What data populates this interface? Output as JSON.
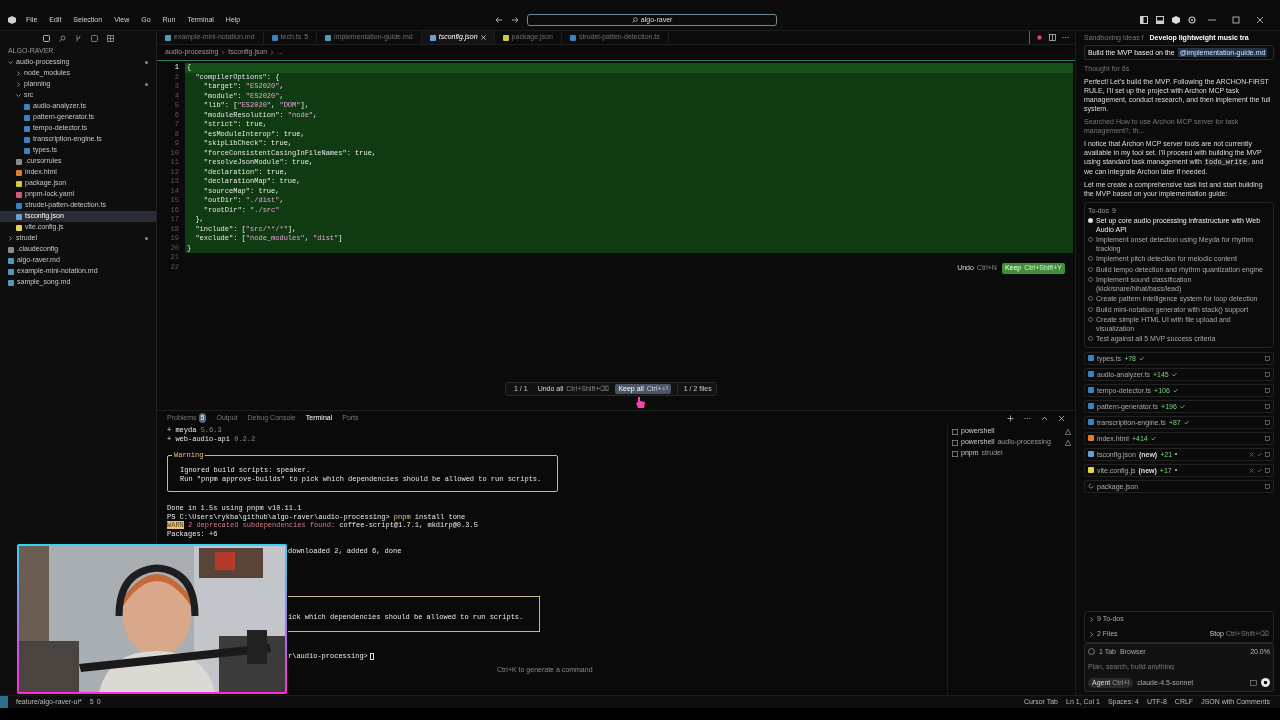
{
  "menu": [
    "File",
    "Edit",
    "Selection",
    "View",
    "Go",
    "Run",
    "Terminal",
    "Help"
  ],
  "search": "algo-raver",
  "explorer": {
    "title": "ALGO-RAVER",
    "tree": [
      {
        "name": "audio-processing",
        "kind": "folder",
        "expanded": true,
        "modified": true,
        "selected": false,
        "children": [
          {
            "name": "node_modules",
            "kind": "folder",
            "expanded": false,
            "modified": false,
            "selected": false
          },
          {
            "name": "planning",
            "kind": "folder",
            "expanded": false,
            "modified": true,
            "selected": false
          },
          {
            "name": "src",
            "kind": "folder",
            "expanded": true,
            "modified": false,
            "selected": false,
            "children": [
              {
                "name": "audio-analyzer.ts",
                "kind": "ts",
                "modified": false,
                "selected": false
              },
              {
                "name": "pattern-generator.ts",
                "kind": "ts",
                "modified": false,
                "selected": false
              },
              {
                "name": "tempo-detector.ts",
                "kind": "ts",
                "modified": false,
                "selected": false
              },
              {
                "name": "transcription-engine.ts",
                "kind": "ts",
                "modified": false,
                "selected": false
              },
              {
                "name": "types.ts",
                "kind": "ts",
                "modified": false,
                "selected": false
              }
            ]
          },
          {
            "name": ".cursorrules",
            "kind": "config",
            "modified": false,
            "selected": false
          },
          {
            "name": "index.html",
            "kind": "html",
            "modified": false,
            "selected": false
          },
          {
            "name": "package.json",
            "kind": "json",
            "modified": false,
            "selected": false
          },
          {
            "name": "pnpm-lock.yaml",
            "kind": "yaml",
            "modified": false,
            "selected": false
          },
          {
            "name": "strudel-patten-detection.ts",
            "kind": "ts",
            "modified": false,
            "selected": false
          },
          {
            "name": "tsconfig.json",
            "kind": "tsconfig",
            "modified": false,
            "selected": true
          },
          {
            "name": "vite.config.js",
            "kind": "js",
            "modified": false,
            "selected": false
          }
        ]
      },
      {
        "name": "strudel",
        "kind": "folder",
        "expanded": false,
        "modified": true,
        "selected": false
      },
      {
        "name": ".claudeconfig",
        "kind": "config",
        "modified": false,
        "selected": false
      },
      {
        "name": "algo-raver.md",
        "kind": "md",
        "modified": false,
        "selected": false
      },
      {
        "name": "example-mini-notation.md",
        "kind": "md",
        "modified": false,
        "selected": false
      },
      {
        "name": "sample_song.md",
        "kind": "md",
        "modified": false,
        "selected": false
      }
    ]
  },
  "tabs": [
    {
      "label": "example-mini-notation.md",
      "kind": "md",
      "selected": false
    },
    {
      "label": "tech.ts",
      "kind": "ts",
      "badge": "5",
      "selected": false
    },
    {
      "label": "implementation-guide.md",
      "kind": "md",
      "selected": false
    },
    {
      "label": "tsconfig.json",
      "kind": "tsconfig",
      "selected": true
    },
    {
      "label": "package.json",
      "kind": "json",
      "selected": false
    },
    {
      "label": "strudel-patten-detection.ts",
      "kind": "ts",
      "selected": false
    }
  ],
  "breadcrumbs": [
    "audio-processing",
    "tsconfig.json",
    "..."
  ],
  "code": [
    {
      "number": "1",
      "text": "{",
      "active": true
    },
    {
      "number": "2",
      "text": "  \"compilerOptions\": {",
      "active": false
    },
    {
      "number": "3",
      "text": "    \"target\": \"ES2020\",",
      "active": false
    },
    {
      "number": "4",
      "text": "    \"module\": \"ES2020\",",
      "active": false
    },
    {
      "number": "5",
      "text": "    \"lib\": [\"ES2020\", \"DOM\"],",
      "active": false
    },
    {
      "number": "6",
      "text": "    \"moduleResolution\": \"node\",",
      "active": false
    },
    {
      "number": "7",
      "text": "    \"strict\": true,",
      "active": false
    },
    {
      "number": "8",
      "text": "    \"esModuleInterop\": true,",
      "active": false
    },
    {
      "number": "9",
      "text": "    \"skipLibCheck\": true,",
      "active": false
    },
    {
      "number": "10",
      "text": "    \"forceConsistentCasingInFileNames\": true,",
      "active": false
    },
    {
      "number": "11",
      "text": "    \"resolveJsonModule\": true,",
      "active": false
    },
    {
      "number": "12",
      "text": "    \"declaration\": true,",
      "active": false
    },
    {
      "number": "13",
      "text": "    \"declarationMap\": true,",
      "active": false
    },
    {
      "number": "14",
      "text": "    \"sourceMap\": true,",
      "active": false
    },
    {
      "number": "15",
      "text": "    \"outDir\": \"./dist\",",
      "active": false
    },
    {
      "number": "16",
      "text": "    \"rootDir\": \"./src\"",
      "active": false
    },
    {
      "number": "17",
      "text": "  },",
      "active": false
    },
    {
      "number": "18",
      "text": "  \"include\": [\"src/**/*\"],",
      "active": false
    },
    {
      "number": "19",
      "text": "  \"exclude\": [\"node_modules\", \"dist\"]",
      "active": false
    },
    {
      "number": "20",
      "text": "}",
      "active": false
    },
    {
      "number": "21",
      "active": false
    },
    {
      "number": "22",
      "active": false
    }
  ],
  "inline_actions": {
    "undo": "Undo",
    "undo_shortcut": "Ctrl+N",
    "keep": "Keep",
    "keep_shortcut": "Ctrl+Shift+Y"
  },
  "review_bar": {
    "counter": "1 / 1",
    "undo_all": "Undo all",
    "undo_all_shortcut": "Ctrl+Shift+⌫",
    "keep_all": "Keep all",
    "keep_all_shortcut": "Ctrl+⏎",
    "files": "1 / 2 files"
  },
  "panel": {
    "tabs": [
      {
        "label": "Problems",
        "badge": "5",
        "selected": false
      },
      {
        "label": "Output",
        "selected": false
      },
      {
        "label": "Debug Console",
        "selected": false
      },
      {
        "label": "Terminal",
        "selected": true
      },
      {
        "label": "Ports",
        "selected": false
      }
    ],
    "terminal": [
      {
        "kind": "package",
        "prefix": "+",
        "name": "meyda",
        "version": "5.6.3"
      },
      {
        "kind": "package",
        "prefix": "+",
        "name": "web-audio-api",
        "version": "0.2.2"
      },
      {
        "kind": "box",
        "title": "Warning",
        "lines": [
          "Ignored build scripts: speaker.",
          "Run \"pnpm approve-builds\" to pick which dependencies should be allowed to run scripts."
        ]
      },
      {
        "kind": "text",
        "text": "Done in 1.5s using pnpm v10.11.1"
      },
      {
        "kind": "prompt",
        "path": "PS C:\\Users\\rykba\\github\\algo-raver\\audio-processing>",
        "command": "pnpm",
        "args": "install tone"
      },
      {
        "kind": "warn",
        "badge": "WARN",
        "message": "2 deprecated subdependencies found:",
        "detail": "coffee-script@1.7.1, mkdirp@0.3.5"
      },
      {
        "kind": "text",
        "text": "Packages: +6"
      },
      {
        "kind": "hidden_text",
        "text": "downloaded 2, added 6, done"
      },
      {
        "kind": "hidden_box",
        "lines": [
          "ick which dependencies should be allowed to run scripts."
        ]
      },
      {
        "kind": "hidden_prompt",
        "text": "r\\audio-processing>"
      }
    ],
    "terminals": [
      {
        "label": "powershell",
        "warning": true
      },
      {
        "label": "powershell",
        "detail": "audio-processing",
        "warning": true
      },
      {
        "label": "pnpm",
        "detail": "strudel",
        "warning": false
      }
    ],
    "hint": "Ctrl+K to generate a command"
  },
  "chat": {
    "tabs": [
      {
        "label": "Sandboxing ideas f",
        "selected": false
      },
      {
        "label": "Develop lightweight music tra",
        "selected": true
      }
    ],
    "prompt": "Build the MVP based on the",
    "mention": "@implementation-guide.md",
    "thought": "Thought for 6s",
    "intro": "Perfect! Let's build the MVP. Following the ARCHON-FIRST RULE, I'll set up the project with Archon MCP task management, conduct research, and then implement the full system.",
    "searched": "Searched How to use Archon MCP server for task management?, th...",
    "notice_before": "I notice that Archon MCP server tools are not currently available in my tool set. I'll proceed with building the MVP using standard task management with",
    "notice_code": "todo_write",
    "notice_after": ", and we can integrate Archon later if needed.",
    "plan": "Let me create a comprehensive task list and start building the MVP based on your implementation guide:",
    "todos_title": "To-dos",
    "todos_count": "9",
    "todos": [
      {
        "text": "Set up core audio processing infrastructure with Web Audio API",
        "in_progress": true
      },
      {
        "text": "Implement onset detection using Meyda for rhythm tracking",
        "in_progress": false
      },
      {
        "text": "Implement pitch detection for melodic content",
        "in_progress": false
      },
      {
        "text": "Build tempo detection and rhythm quantization engine",
        "in_progress": false
      },
      {
        "text": "Implement sound classification (kick/snare/hihat/bass/lead)",
        "in_progress": false
      },
      {
        "text": "Create pattern intelligence system for loop detection",
        "in_progress": false
      },
      {
        "text": "Build mini-notation generator with stack() support",
        "in_progress": false
      },
      {
        "text": "Create simple HTML UI with file upload and visualization",
        "in_progress": false
      },
      {
        "text": "Test against all 5 MVP success criteria",
        "in_progress": false
      }
    ],
    "files": [
      {
        "name": "types.ts",
        "kind": "ts",
        "added": "+78",
        "accepted": true,
        "loading": false
      },
      {
        "name": "audio-analyzer.ts",
        "kind": "ts",
        "added": "+145",
        "accepted": true,
        "loading": false
      },
      {
        "name": "tempo-detector.ts",
        "kind": "ts",
        "added": "+106",
        "accepted": true,
        "loading": false
      },
      {
        "name": "pattern-generator.ts",
        "kind": "ts",
        "added": "+196",
        "accepted": true,
        "loading": false
      },
      {
        "name": "transcription-engine.ts",
        "kind": "ts",
        "added": "+87",
        "accepted": true,
        "loading": false
      },
      {
        "name": "index.html",
        "kind": "html",
        "added": "+414",
        "accepted": true,
        "loading": false
      },
      {
        "name": "tsconfig.json",
        "kind": "tsconfig",
        "new": "(new)",
        "added": "+21",
        "accepted": false,
        "loading": false
      },
      {
        "name": "vite.config.js",
        "kind": "js",
        "new": "(new)",
        "added": "+17",
        "accepted": false,
        "loading": false
      },
      {
        "name": "package.json",
        "accepted": false,
        "loading": true
      }
    ],
    "summary": [
      {
        "label": "9 To-dos"
      },
      {
        "label": "2 Files",
        "action": "Stop",
        "shortcut": "Ctrl+Shift+⌫"
      }
    ],
    "context_tab": "1 Tab",
    "browser": "Browser",
    "usage": "20.0%",
    "placeholder": "Plan, search, build anything",
    "mode": "Agent",
    "mode_shortcut": "Ctrl+I",
    "model": "claude-4.5-sonnet"
  },
  "status_bar": {
    "branch": "feature/algo-raver-ui*",
    "errors": "5",
    "warnings": "0",
    "right": [
      "Cursor Tab",
      "Ln 1, Col 1",
      "Spaces: 4",
      "UTF-8",
      "CRLF",
      "JSON with Comments"
    ]
  }
}
